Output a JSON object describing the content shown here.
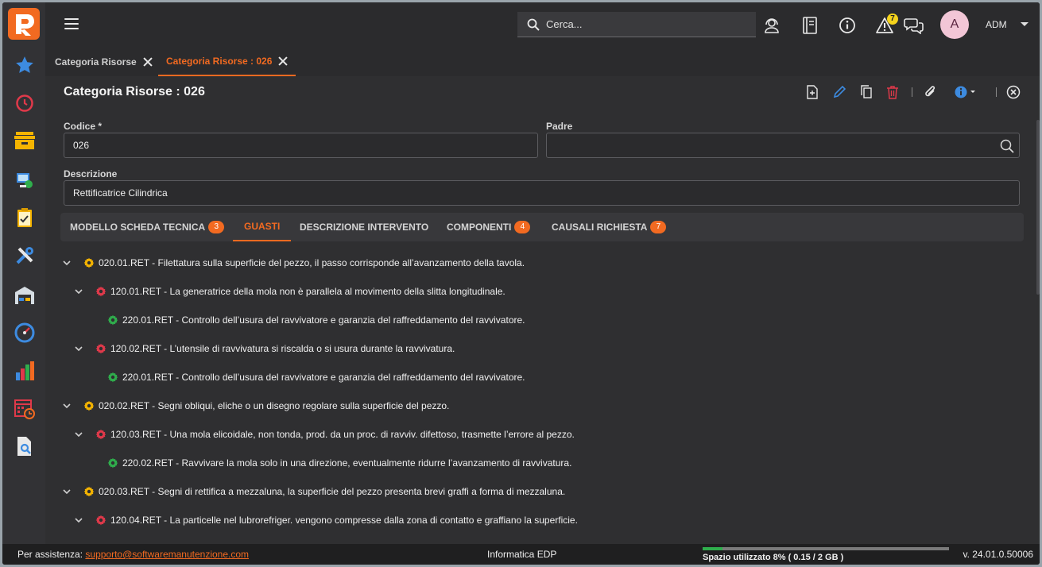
{
  "app": {
    "logo_label": "R"
  },
  "topbar": {
    "search_placeholder": "Cerca...",
    "notification_count": "7",
    "avatar_initial": "A",
    "user_name": "ADM"
  },
  "tabs": [
    {
      "label": "Categoria Risorse"
    },
    {
      "label": "Categoria Risorse : 026"
    }
  ],
  "page": {
    "title": "Categoria Risorse : 026",
    "fields": {
      "codice_label": "Codice *",
      "codice_value": "026",
      "padre_label": "Padre",
      "padre_value": "",
      "descrizione_label": "Descrizione",
      "descrizione_value": "Rettificatrice Cilindrica"
    }
  },
  "subtabs": [
    {
      "label": "MODELLO SCHEDA TECNICA",
      "count": "3"
    },
    {
      "label": "GUASTI",
      "count": ""
    },
    {
      "label": "DESCRIZIONE INTERVENTO",
      "count": ""
    },
    {
      "label": "COMPONENTI",
      "count": "4"
    },
    {
      "label": "CAUSALI RICHIESTA",
      "count": "7"
    }
  ],
  "tree": [
    {
      "level": 0,
      "text": "020.01.RET - Filettatura sulla superficie del pezzo, il passo corrisponde all’avanzamento della tavola."
    },
    {
      "level": 1,
      "text": "120.01.RET - La generatrice della mola non è parallela al movimento della slitta longitudinale."
    },
    {
      "level": 2,
      "text": "220.01.RET - Controllo dell’usura del ravvivatore e garanzia del raffreddamento del ravvivatore."
    },
    {
      "level": 1,
      "text": "120.02.RET - L’utensile di ravvivatura si riscalda o si usura durante la ravvivatura."
    },
    {
      "level": 2,
      "text": "220.01.RET - Controllo dell’usura del ravvivatore e garanzia del raffreddamento del ravvivatore."
    },
    {
      "level": 0,
      "text": "020.02.RET - Segni obliqui, eliche o un disegno regolare sulla superficie del pezzo."
    },
    {
      "level": 1,
      "text": "120.03.RET - Una mola elicoidale, non tonda, prod. da un proc. di ravviv. difettoso, trasmette l’errore al pezzo."
    },
    {
      "level": 2,
      "text": "220.02.RET - Ravvivare la mola solo in una direzione, eventualmente ridurre l’avanzamento di ravvivatura."
    },
    {
      "level": 0,
      "text": "020.03.RET -  Segni di rettifica a mezzaluna, la superficie del pezzo presenta brevi graffi a forma di mezzaluna."
    },
    {
      "level": 1,
      "text": "120.04.RET - La particelle nel lubrorefriger. vengono compresse dalla zona di contatto e graffiano la superficie."
    }
  ],
  "colors": {
    "accent": "#f26a21",
    "level0": "#f5b400",
    "level1": "#e0394a",
    "level2": "#2fae4c"
  },
  "footer": {
    "assist_label": "Per assistenza:",
    "assist_email": "supporto@softwaremanutenzione.com",
    "center": "Informatica EDP",
    "space": "Spazio utilizzato 8% ( 0.15 / 2 GB )",
    "space_fraction": 0.08,
    "version": "v. 24.01.0.50006"
  }
}
